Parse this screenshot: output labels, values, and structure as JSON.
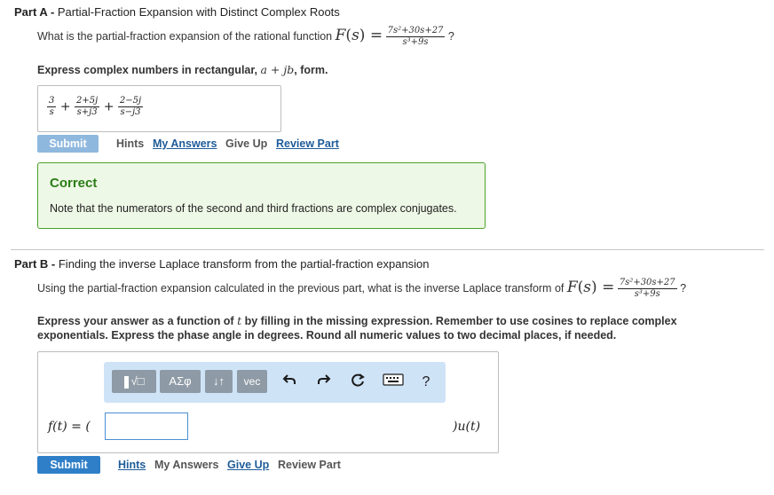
{
  "partA": {
    "label": "Part A",
    "separator": " - ",
    "title": "Partial-Fraction Expansion with Distinct Complex Roots",
    "question": "What is the partial-fraction expansion of the rational function",
    "function_name": "F",
    "function_var": "s",
    "equals": "=",
    "numerator": "7s²+30s+27",
    "denominator": "s³+9s",
    "question_end": "?",
    "instruction_prefix": "Express complex numbers in rectangular,",
    "instruction_math": "a + jb",
    "instruction_suffix": ", form.",
    "answer": {
      "f1_num": "3",
      "f1_den": "s",
      "plus": "+",
      "f2_num": "2+5j",
      "f2_den": "s+j3",
      "f3_num": "2−5j",
      "f3_den": "s−j3"
    },
    "actions": {
      "submit": "Submit",
      "hints": "Hints",
      "my_answers": "My Answers",
      "give_up": "Give Up",
      "review_part": "Review Part"
    },
    "feedback": {
      "title": "Correct",
      "message": "Note that the numerators of the second and third fractions are complex conjugates."
    }
  },
  "partB": {
    "label": "Part B",
    "separator": " - ",
    "title": "Finding the inverse Laplace transform from the partial-fraction expansion",
    "question": "Using the partial-fraction expansion calculated in the previous part, what is the inverse Laplace transform of",
    "function_name": "F",
    "function_var": "s",
    "equals": "=",
    "numerator": "7s²+30s+27",
    "denominator": "s³+9s",
    "question_end": "?",
    "instruction_1a": "Express your answer as a function of",
    "instruction_var": "t",
    "instruction_1b": "by filling in the missing expression. Remember to use cosines to replace complex",
    "instruction_2": "exponentials. Express the phase angle in degrees. Round all numeric values to two decimal places, if needed.",
    "toolbar": {
      "templates": "√□",
      "greek": "ΑΣφ",
      "arrows": "↓↑",
      "vec": "vec",
      "help": "?"
    },
    "lhs": "f(t) = (",
    "rhs": ")u(t)",
    "actions": {
      "submit": "Submit",
      "hints": "Hints",
      "my_answers": "My Answers",
      "give_up": "Give Up",
      "review_part": "Review Part"
    }
  },
  "colors": {
    "submit_disabled": "#8fb8de",
    "submit_active": "#2f7fc8",
    "correct_text": "#2a7d16",
    "correct_border": "#4aa12c",
    "correct_bg": "#eef8e6",
    "link": "#1f5c99",
    "toolbar_bg": "#cfe3f7"
  }
}
